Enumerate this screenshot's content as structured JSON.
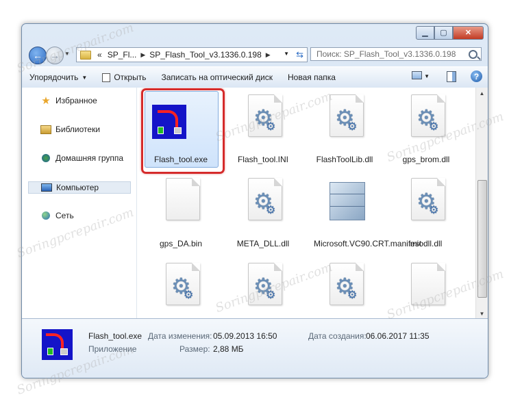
{
  "breadcrumb": {
    "overflow": "«",
    "items": [
      "SP_Fl...",
      "SP_Flash_Tool_v3.1336.0.198"
    ]
  },
  "search": {
    "placeholder": "Поиск: SP_Flash_Tool_v3.1336.0.198"
  },
  "toolbar": {
    "organize": "Упорядочить",
    "open": "Открыть",
    "burn": "Записать на оптический диск",
    "new_folder": "Новая папка"
  },
  "sidebar": {
    "items": [
      {
        "label": "Избранное",
        "icon": "star-icon"
      },
      {
        "label": "Библиотеки",
        "icon": "libraries-icon"
      },
      {
        "label": "Домашняя группа",
        "icon": "homegroup-icon"
      },
      {
        "label": "Компьютер",
        "icon": "computer-icon"
      },
      {
        "label": "Сеть",
        "icon": "network-icon"
      }
    ]
  },
  "files": [
    {
      "name": "Flash_tool.exe",
      "type": "exe",
      "selected": true
    },
    {
      "name": "Flash_tool.INI",
      "type": "ini"
    },
    {
      "name": "FlashToolLib.dll",
      "type": "dll"
    },
    {
      "name": "gps_brom.dll",
      "type": "dll"
    },
    {
      "name": "gps_DA.bin",
      "type": "blank"
    },
    {
      "name": "META_DLL.dll",
      "type": "dll"
    },
    {
      "name": "Microsoft.VC90.CRT.manifest",
      "type": "manifest"
    },
    {
      "name": "miodll.dll",
      "type": "dll"
    },
    {
      "name": "",
      "type": "dll"
    },
    {
      "name": "",
      "type": "dll"
    },
    {
      "name": "",
      "type": "dll"
    },
    {
      "name": "",
      "type": "blank"
    }
  ],
  "details": {
    "filename": "Flash_tool.exe",
    "filetype": "Приложение",
    "modified_label": "Дата изменения:",
    "modified_value": "05.09.2013 16:50",
    "size_label": "Размер:",
    "size_value": "2,88 МБ",
    "created_label": "Дата создания:",
    "created_value": "06.06.2017 11:35"
  },
  "watermark": "Soringpcrepair.com",
  "colors": {
    "highlight_frame": "#d52b2b",
    "selection": "#cfe3fb",
    "exe_bg": "#1414c8"
  }
}
